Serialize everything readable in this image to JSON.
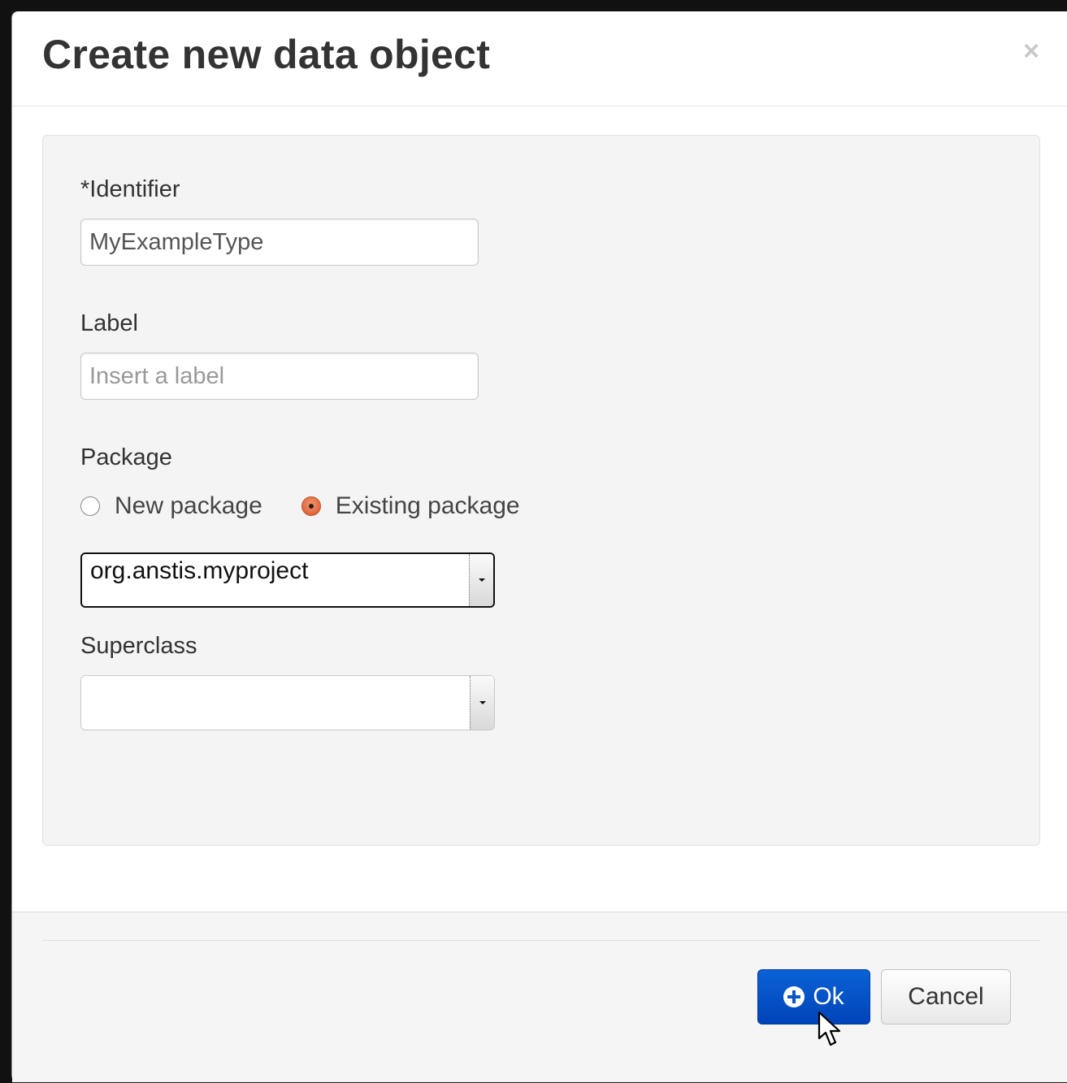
{
  "dialog": {
    "title": "Create new data object",
    "close_glyph": "×"
  },
  "form": {
    "identifier": {
      "label": "*Identifier",
      "value": "MyExampleType"
    },
    "label": {
      "label": "Label",
      "placeholder": "Insert a label",
      "value": ""
    },
    "package": {
      "label": "Package",
      "options": [
        {
          "label": "New package",
          "checked": false
        },
        {
          "label": "Existing package",
          "checked": true
        }
      ],
      "selected": "org.anstis.myproject"
    },
    "superclass": {
      "label": "Superclass",
      "selected": ""
    }
  },
  "footer": {
    "ok_label": "Ok",
    "cancel_label": "Cancel"
  },
  "icons": {
    "ok": "plus-circle-icon",
    "close": "close-icon",
    "cursor": "mouse-pointer-icon",
    "dropdown": "caret-down-icon"
  },
  "colors": {
    "primary": "#0044b8",
    "radio_accent": "#e0673c",
    "well_bg": "#f4f4f4"
  }
}
